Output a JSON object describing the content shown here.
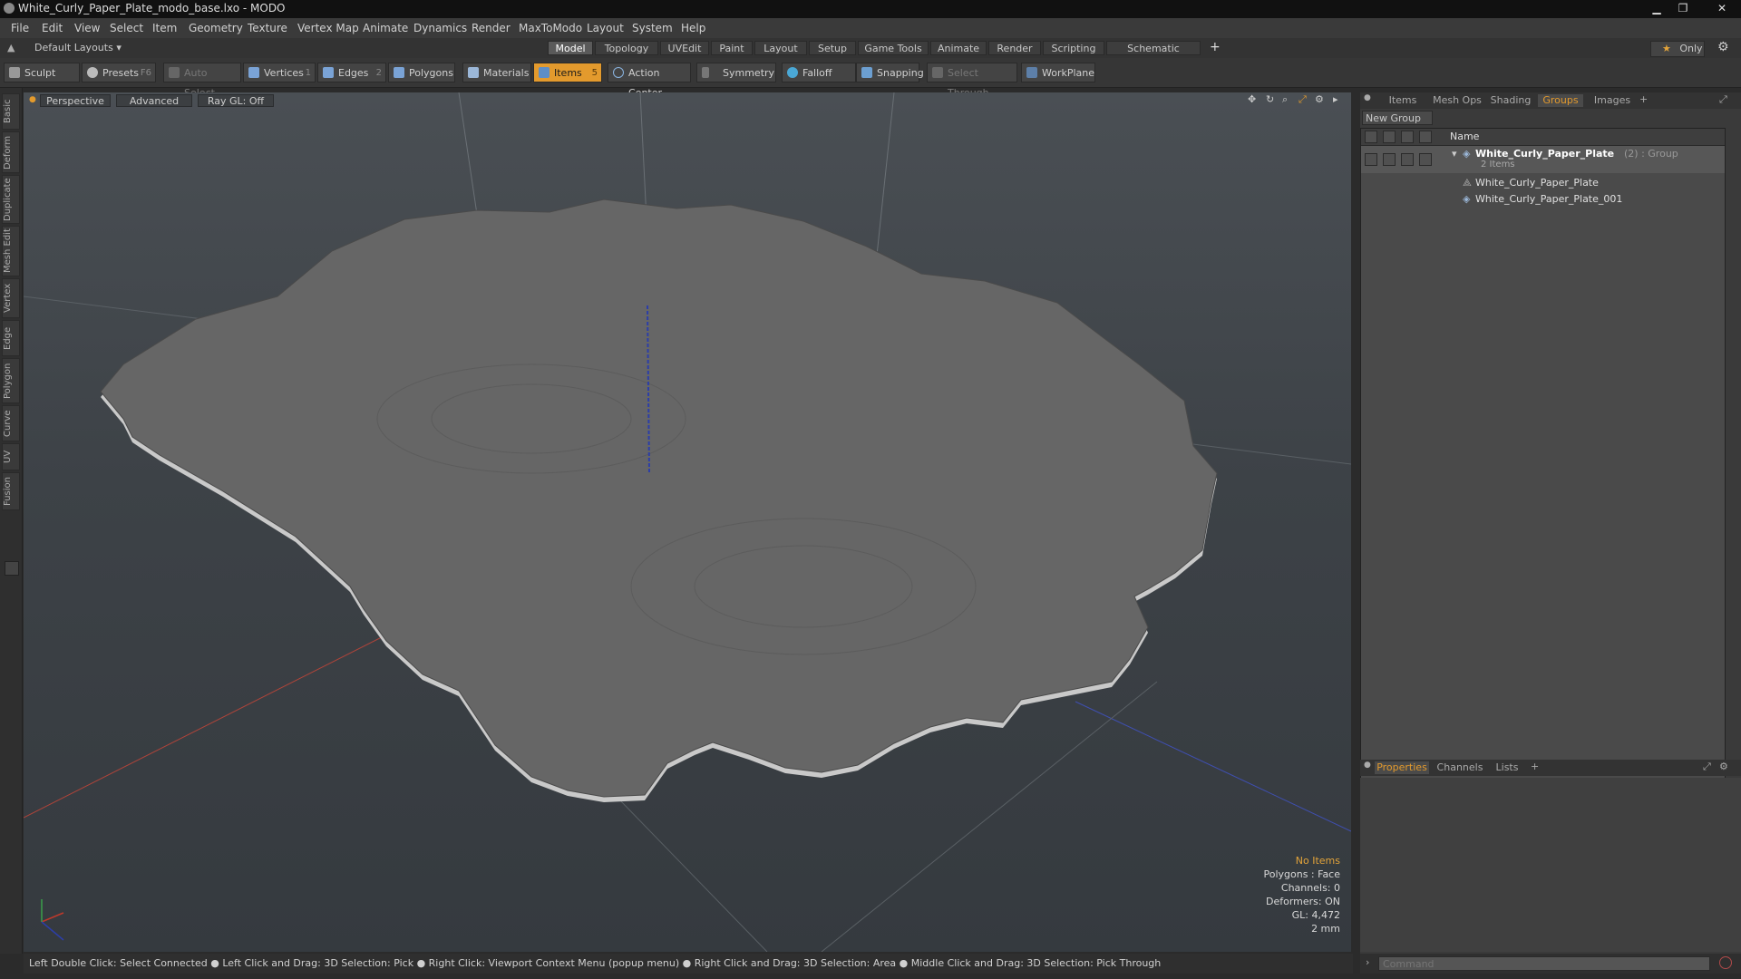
{
  "titlebar": {
    "title": "White_Curly_Paper_Plate_modo_base.lxo - MODO",
    "min": "▁",
    "max": "❐",
    "close": "✕"
  },
  "menu": [
    "File",
    "Edit",
    "View",
    "Select",
    "Item",
    "Geometry",
    "Texture",
    "Vertex Map",
    "Animate",
    "Dynamics",
    "Render",
    "MaxToModo",
    "Layout",
    "System",
    "Help"
  ],
  "layout_bar": {
    "layout_name": "Default Layouts",
    "tabs": [
      "Model",
      "Topology",
      "UVEdit",
      "Paint",
      "Layout",
      "Setup",
      "Game Tools",
      "Animate",
      "Render",
      "Scripting",
      "Schematic Fusion"
    ],
    "active_tab": "Model",
    "add_tab": "+",
    "only": "Only",
    "star": "★",
    "gear": "⚙"
  },
  "toolbar": {
    "sculpt": "Sculpt",
    "presets": "Presets",
    "presets_key": "F6",
    "auto_select": "Auto Select",
    "vertices": "Vertices",
    "vertices_key": "1",
    "edges": "Edges",
    "edges_key": "2",
    "polygons": "Polygons",
    "materials": "Materials",
    "items": "Items",
    "items_key": "5",
    "action_center": "Action Center",
    "symmetry": "Symmetry",
    "falloff": "Falloff",
    "snapping": "Snapping",
    "select_through": "Select Through",
    "workplane": "WorkPlane"
  },
  "left_tabs": [
    "Basic",
    "Deform",
    "Duplicate",
    "Mesh Edit",
    "Vertex",
    "Edge",
    "Polygon",
    "Curve",
    "UV",
    "Fusion"
  ],
  "viewport": {
    "view": "Perspective",
    "shading": "Advanced",
    "raygl": "Ray GL: Off",
    "info": {
      "items": "No Items",
      "polygons": "Polygons : Face",
      "channels": "Channels: 0",
      "deformers": "Deformers: ON",
      "gl": "GL: 4,472",
      "unit": "2 mm"
    }
  },
  "status": {
    "hint": "Left Double Click: Select Connected ● Left Click and Drag: 3D Selection: Pick ● Right Click: Viewport Context Menu (popup menu) ● Right Click and Drag: 3D Selection: Area ● Middle Click and Drag: 3D Selection: Pick Through"
  },
  "right_panel": {
    "top_tabs": [
      "Items",
      "Mesh Ops",
      "Shading",
      "Groups",
      "Images"
    ],
    "active_top_tab": "Groups",
    "new_group": "New Group",
    "column_name": "Name",
    "group": {
      "name": "White_Curly_Paper_Plate",
      "suffix": "(2) : Group",
      "count": "2 Items"
    },
    "children": [
      "White_Curly_Paper_Plate",
      "White_Curly_Paper_Plate_001"
    ],
    "bottom_tabs": [
      "Properties",
      "Channels",
      "Lists"
    ],
    "active_bottom_tab": "Properties",
    "command_placeholder": "Command"
  },
  "colors": {
    "accent": "#e39a2d",
    "x_axis": "#c0392b",
    "z_axis": "#2c3ea8"
  }
}
